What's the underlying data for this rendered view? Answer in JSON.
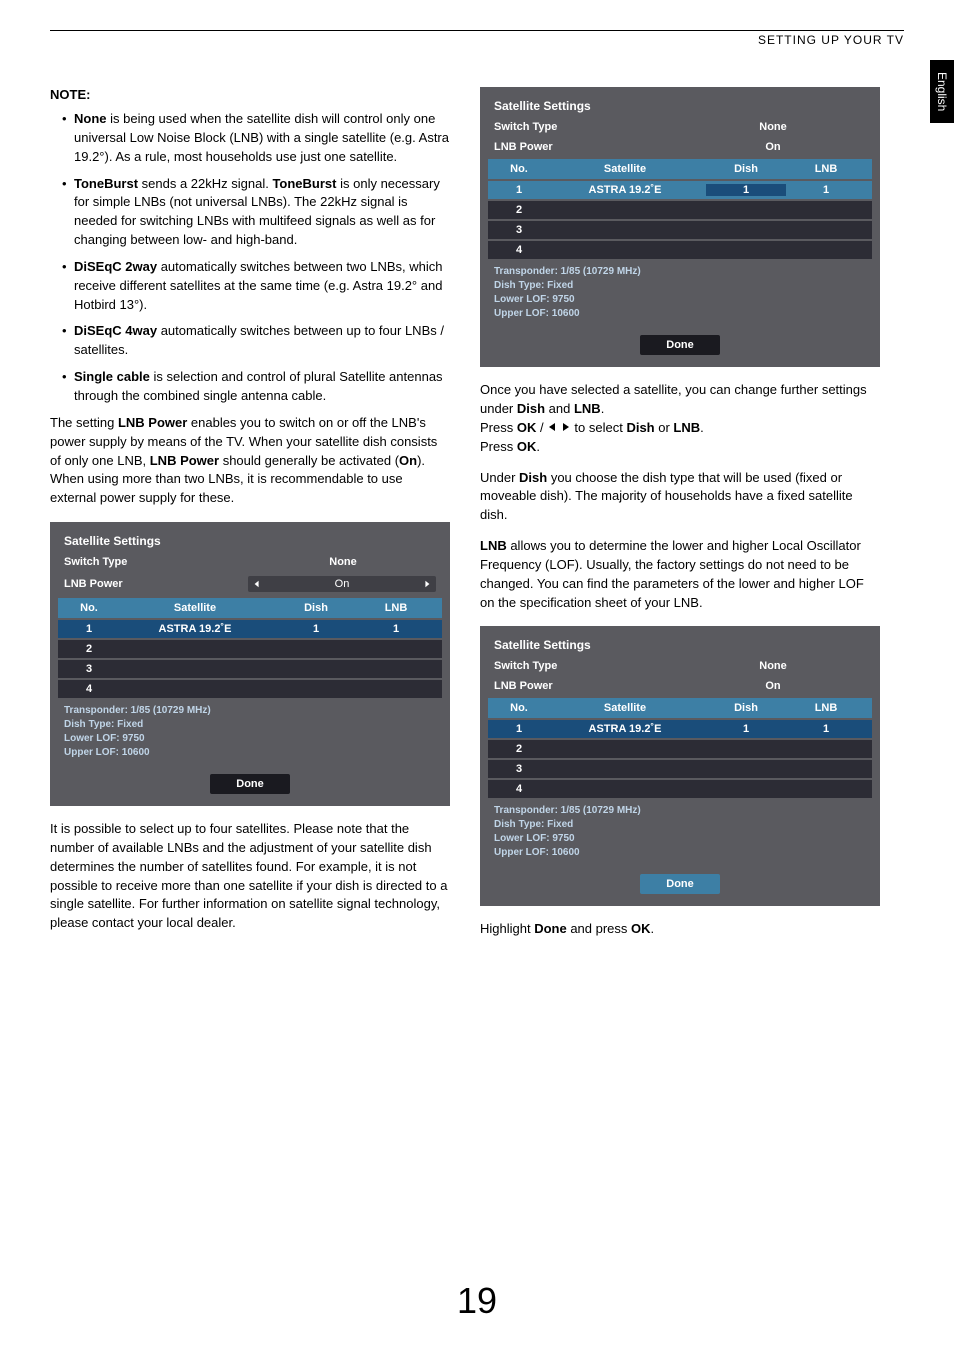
{
  "header": "SETTING UP YOUR TV",
  "langTab": "English",
  "pageNumber": "19",
  "left": {
    "noteHeading": "NOTE:",
    "bullets": [
      {
        "b": "None",
        "rest": " is being used when the satellite dish will control only one universal Low Noise Block (LNB) with a single satellite (e.g. Astra 19.2°). As a rule, most households use just one satellite."
      },
      {
        "b": "ToneBurst",
        "rest": " sends a 22kHz signal. ",
        "b2": "ToneBurst",
        "rest2": " is only necessary for simple LNBs (not universal LNBs). The 22kHz signal is needed for switching LNBs with multifeed signals as well as for changing between low- and high-band."
      },
      {
        "b": "DiSEqC 2way",
        "rest": " automatically switches between two LNBs, which receive different satellites at the same time (e.g. Astra 19.2° and Hotbird 13°)."
      },
      {
        "b": "DiSEqC 4way",
        "rest": " automatically switches between up to four LNBs / satellites."
      },
      {
        "b": "Single cable",
        "rest": " is selection and control of plural Satellite antennas through the combined single antenna cable."
      }
    ],
    "para1": {
      "pre": "The setting ",
      "b1": "LNB Power",
      "mid": " enables you to switch on or off the LNB's power supply by means of the TV. When your satellite dish consists of only one LNB, ",
      "b2": "LNB Power",
      "mid2": " should generally be activated (",
      "b3": "On",
      "post": "). When using more than two LNBs, it is recommendable to use external power supply for these."
    },
    "panel1": {
      "title": "Satellite Settings",
      "switchLabel": "Switch Type",
      "switchValue": "None",
      "lnbLabel": "LNB Power",
      "lnbValue": "On",
      "thNo": "No.",
      "thSat": "Satellite",
      "thDish": "Dish",
      "thLnb": "LNB",
      "rows": [
        {
          "no": "1",
          "sat": "ASTRA 19.2˚E",
          "dish": "1",
          "lnb": "1"
        },
        {
          "no": "2",
          "sat": "",
          "dish": "",
          "lnb": ""
        },
        {
          "no": "3",
          "sat": "",
          "dish": "",
          "lnb": ""
        },
        {
          "no": "4",
          "sat": "",
          "dish": "",
          "lnb": ""
        }
      ],
      "info": "Transponder: 1/85 (10729 MHz)\nDish Type: Fixed\nLower LOF: 9750\nUpper LOF: 10600",
      "done": "Done",
      "editable": true
    },
    "para2": "It is possible to select up to four satellites. Please note that the number of available LNBs and the adjustment of your satellite dish determines the number of satellites found. For example, it is not possible to receive more than one satellite if your dish is directed to a single satellite. For further information on satellite signal technology, please contact your local dealer."
  },
  "right": {
    "panel2": {
      "title": "Satellite Settings",
      "switchLabel": "Switch Type",
      "switchValue": "None",
      "lnbLabel": "LNB Power",
      "lnbValue": "On",
      "thNo": "No.",
      "thSat": "Satellite",
      "thDish": "Dish",
      "thLnb": "LNB",
      "rows": [
        {
          "no": "1",
          "sat": "ASTRA 19.2˚E",
          "dish": "1",
          "lnb": "1"
        },
        {
          "no": "2",
          "sat": "",
          "dish": "",
          "lnb": ""
        },
        {
          "no": "3",
          "sat": "",
          "dish": "",
          "lnb": ""
        },
        {
          "no": "4",
          "sat": "",
          "dish": "",
          "lnb": ""
        }
      ],
      "info": "Transponder: 1/85 (10729 MHz)\nDish Type: Fixed\nLower LOF: 9750\nUpper LOF: 10600",
      "done": "Done",
      "selectedDish": true
    },
    "para1": {
      "l1": "Once you have selected a satellite, you can change further settings under ",
      "b1": "Dish",
      "l2": " and ",
      "b2": "LNB",
      "l3": ".",
      "l4": "Press ",
      "b3": "OK",
      "l5": " / ",
      "l6": " to select ",
      "b4": "Dish",
      "l7": " or ",
      "b5": "LNB",
      "l8": ".",
      "l9": "Press ",
      "b6": "OK",
      "l10": "."
    },
    "para2": {
      "l1": " Under ",
      "b1": "Dish",
      "l2": " you choose the dish type that will be used (fixed or moveable dish). The majority of households have a fixed satellite dish."
    },
    "para3": {
      "b1": "LNB",
      "l1": " allows you to determine the lower and higher Local Oscillator Frequency (LOF). Usually, the factory settings do not need to be changed. You can find the parameters of the lower and higher LOF on the specification sheet of your LNB."
    },
    "panel3": {
      "title": "Satellite Settings",
      "switchLabel": "Switch Type",
      "switchValue": "None",
      "lnbLabel": "LNB Power",
      "lnbValue": "On",
      "thNo": "No.",
      "thSat": "Satellite",
      "thDish": "Dish",
      "thLnb": "LNB",
      "rows": [
        {
          "no": "1",
          "sat": "ASTRA 19.2˚E",
          "dish": "1",
          "lnb": "1"
        },
        {
          "no": "2",
          "sat": "",
          "dish": "",
          "lnb": ""
        },
        {
          "no": "3",
          "sat": "",
          "dish": "",
          "lnb": ""
        },
        {
          "no": "4",
          "sat": "",
          "dish": "",
          "lnb": ""
        }
      ],
      "info": "Transponder: 1/85 (10729 MHz)\nDish Type: Fixed\nLower LOF: 9750\nUpper LOF: 10600",
      "done": "Done",
      "highlightDone": true
    },
    "para4": {
      "l1": "Highlight ",
      "b1": "Done",
      "l2": " and press ",
      "b2": "OK",
      "l3": "."
    }
  }
}
